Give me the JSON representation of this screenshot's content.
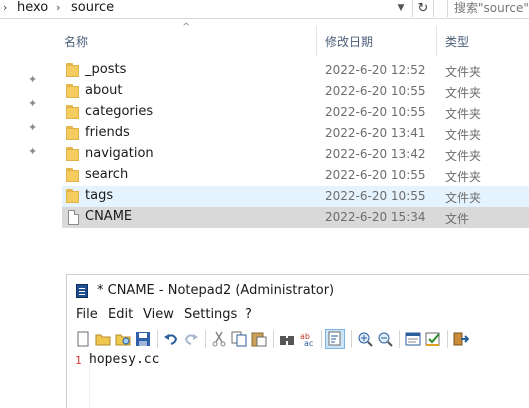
{
  "breadcrumb": {
    "items": [
      "hexo",
      "source"
    ],
    "separator": "›",
    "first_separator": "›"
  },
  "search": {
    "placeholder": "搜索\"source\""
  },
  "columns": {
    "name": "名称",
    "date": "修改日期",
    "type": "类型"
  },
  "files": [
    {
      "name": "_posts",
      "date": "2022-6-20 12:52",
      "type": "文件夹",
      "kind": "folder"
    },
    {
      "name": "about",
      "date": "2022-6-20 10:55",
      "type": "文件夹",
      "kind": "folder"
    },
    {
      "name": "categories",
      "date": "2022-6-20 10:55",
      "type": "文件夹",
      "kind": "folder"
    },
    {
      "name": "friends",
      "date": "2022-6-20 13:41",
      "type": "文件夹",
      "kind": "folder"
    },
    {
      "name": "navigation",
      "date": "2022-6-20 13:42",
      "type": "文件夹",
      "kind": "folder"
    },
    {
      "name": "search",
      "date": "2022-6-20 10:55",
      "type": "文件夹",
      "kind": "folder"
    },
    {
      "name": "tags",
      "date": "2022-6-20 10:55",
      "type": "文件夹",
      "kind": "folder",
      "state": "hover"
    },
    {
      "name": "CNAME",
      "date": "2022-6-20 15:34",
      "type": "文件",
      "kind": "file",
      "state": "selected"
    }
  ],
  "notepad": {
    "title": "* CNAME - Notepad2 (Administrator)",
    "menu": [
      "File",
      "Edit",
      "View",
      "Settings",
      "?"
    ],
    "line_number": "1",
    "content": "hopesy.cc"
  },
  "colors": {
    "hover_row": "#e5f3ff",
    "selected_row": "#d9d9d9",
    "folder": "#f5cd5f",
    "header_text": "#4c607a",
    "line_number": "#dd3333"
  }
}
